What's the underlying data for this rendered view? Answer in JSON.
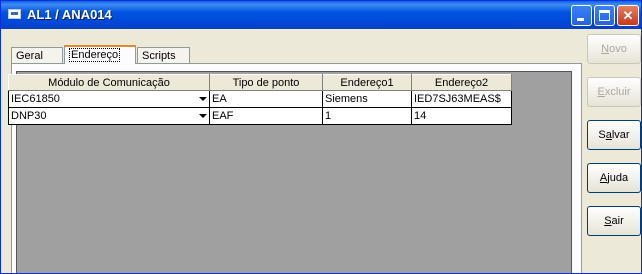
{
  "window": {
    "title": "AL1 / ANA014"
  },
  "tabs": [
    {
      "label": "Geral"
    },
    {
      "label": "Endereço"
    },
    {
      "label": "Scripts"
    }
  ],
  "table": {
    "columns": [
      "Módulo de Comunicação",
      "Tipo de ponto",
      "Endereço1",
      "Endereço2"
    ],
    "rows": [
      {
        "modulo": "IEC61850",
        "tipo": "EA",
        "endereco1": "Siemens",
        "endereco2": "IED7SJ63MEAS$"
      },
      {
        "modulo": "DNP30",
        "tipo": "EAF",
        "endereco1": "1",
        "endereco2": "14"
      }
    ]
  },
  "buttons": {
    "novo": {
      "underline": "N",
      "rest": "ovo"
    },
    "excluir": {
      "underline": "E",
      "rest": "xcluir"
    },
    "salvar": {
      "pre": "S",
      "underline": "a",
      "rest": "lvar"
    },
    "ajuda": {
      "underline": "A",
      "rest": "juda"
    },
    "sair": {
      "underline": "S",
      "rest": "air"
    }
  },
  "colors": {
    "titlebar": "#0054E3",
    "grid_background": "#A0A0A0",
    "tab_highlight": "#E68B2C"
  }
}
